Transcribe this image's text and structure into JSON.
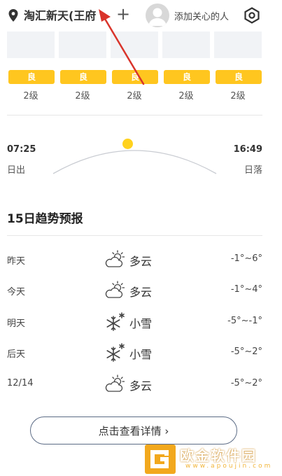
{
  "header": {
    "location": "淘汇新天(王府",
    "add_label": "+",
    "care_label": "添加关心的人"
  },
  "hourly": [
    {
      "aqi": "良",
      "level": "2级"
    },
    {
      "aqi": "良",
      "level": "2级"
    },
    {
      "aqi": "良",
      "level": "2级"
    },
    {
      "aqi": "良",
      "level": "2级"
    },
    {
      "aqi": "良",
      "level": "2级"
    }
  ],
  "sun": {
    "sunrise_time": "07:25",
    "sunrise_label": "日出",
    "sunset_time": "16:49",
    "sunset_label": "日落"
  },
  "forecast": {
    "title": "15日趋势预报",
    "days": [
      {
        "day": "昨天",
        "icon": "partly-cloudy-icon",
        "cond": "多云",
        "temp": "-1°~6°"
      },
      {
        "day": "今天",
        "icon": "partly-cloudy-icon",
        "cond": "多云",
        "temp": "-1°~4°"
      },
      {
        "day": "明天",
        "icon": "snow-icon",
        "cond": "小雪",
        "temp": "-5°~-1°"
      },
      {
        "day": "后天",
        "icon": "snow-icon",
        "cond": "小雪",
        "temp": "-5°~2°"
      },
      {
        "day": "12/14",
        "icon": "partly-cloudy-icon",
        "cond": "多云",
        "temp": "-5°~2°"
      }
    ],
    "detail_button": "点击查看详情 ›"
  },
  "watermark": {
    "text": "欧金软件园",
    "url": "www.apoujin.com"
  },
  "colors": {
    "aqi_good": "#ffc61f",
    "sun": "#ffd21e",
    "arrow": "#d9342b"
  }
}
